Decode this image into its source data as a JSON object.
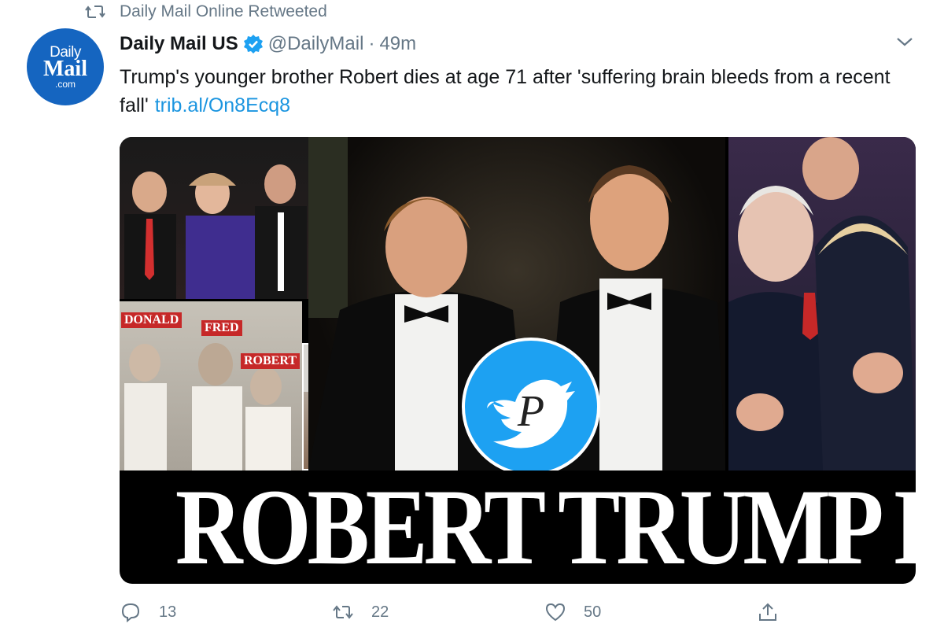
{
  "retweet_context": {
    "text": "Daily Mail Online Retweeted",
    "icon": "retweet-icon"
  },
  "author": {
    "avatar_lines": [
      "Daily",
      "Mail",
      ".com"
    ],
    "display_name": "Daily Mail US",
    "verified_icon": "verified-badge-icon",
    "handle": "@DailyMail",
    "separator": "·",
    "timestamp": "49m"
  },
  "tweet": {
    "text": "Trump's younger brother Robert dies at age 71 after 'suffering brain bleeds from a recent fall'",
    "link": "trib.al/On8Ecq8"
  },
  "media": {
    "labels": {
      "donald": "DONALD",
      "fred": "FRED",
      "robert": "ROBERT"
    },
    "headline": "ROBERT TRUMP DEAD"
  },
  "actions": {
    "reply_count": "13",
    "retweet_count": "22",
    "like_count": "50"
  },
  "colors": {
    "accent": "#1b95e0",
    "muted": "#657786",
    "verified": "#1da1f2",
    "avatar_bg": "#1565c0"
  }
}
